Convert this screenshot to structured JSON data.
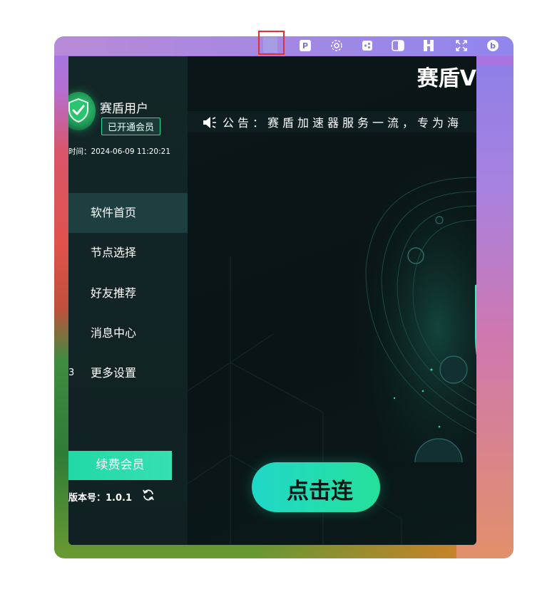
{
  "app": {
    "brand_title": "赛盾V",
    "colors": {
      "accent": "#26dca6",
      "sidebar": "#132627",
      "main_bg": "#0a1618"
    }
  },
  "menubar": {
    "icons": [
      "selected-app-icon",
      "p-badge-icon",
      "gear-flower-icon",
      "dots-square-icon",
      "contrast-icon",
      "bookmark-grid-icon",
      "expand-icon",
      "circle-b-icon"
    ],
    "p_glyph": "P",
    "b_glyph": "b"
  },
  "user": {
    "name": "赛盾用户",
    "vip_badge": "已开通会员",
    "expire_time": "时间：2024-06-09 11:20:21"
  },
  "nav": {
    "items": [
      {
        "label": "软件首页",
        "active": true
      },
      {
        "label": "节点选择",
        "active": false
      },
      {
        "label": "好友推荐",
        "active": false
      },
      {
        "label": "消息中心",
        "active": false
      },
      {
        "label": "更多设置",
        "active": false
      }
    ],
    "settings_marker": "3"
  },
  "renew_label": "续费会员",
  "version_label": "版本号：1.0.1",
  "notice": {
    "text": "公告：赛盾加速器服务一流，专为海"
  },
  "connect_label": "点击连"
}
